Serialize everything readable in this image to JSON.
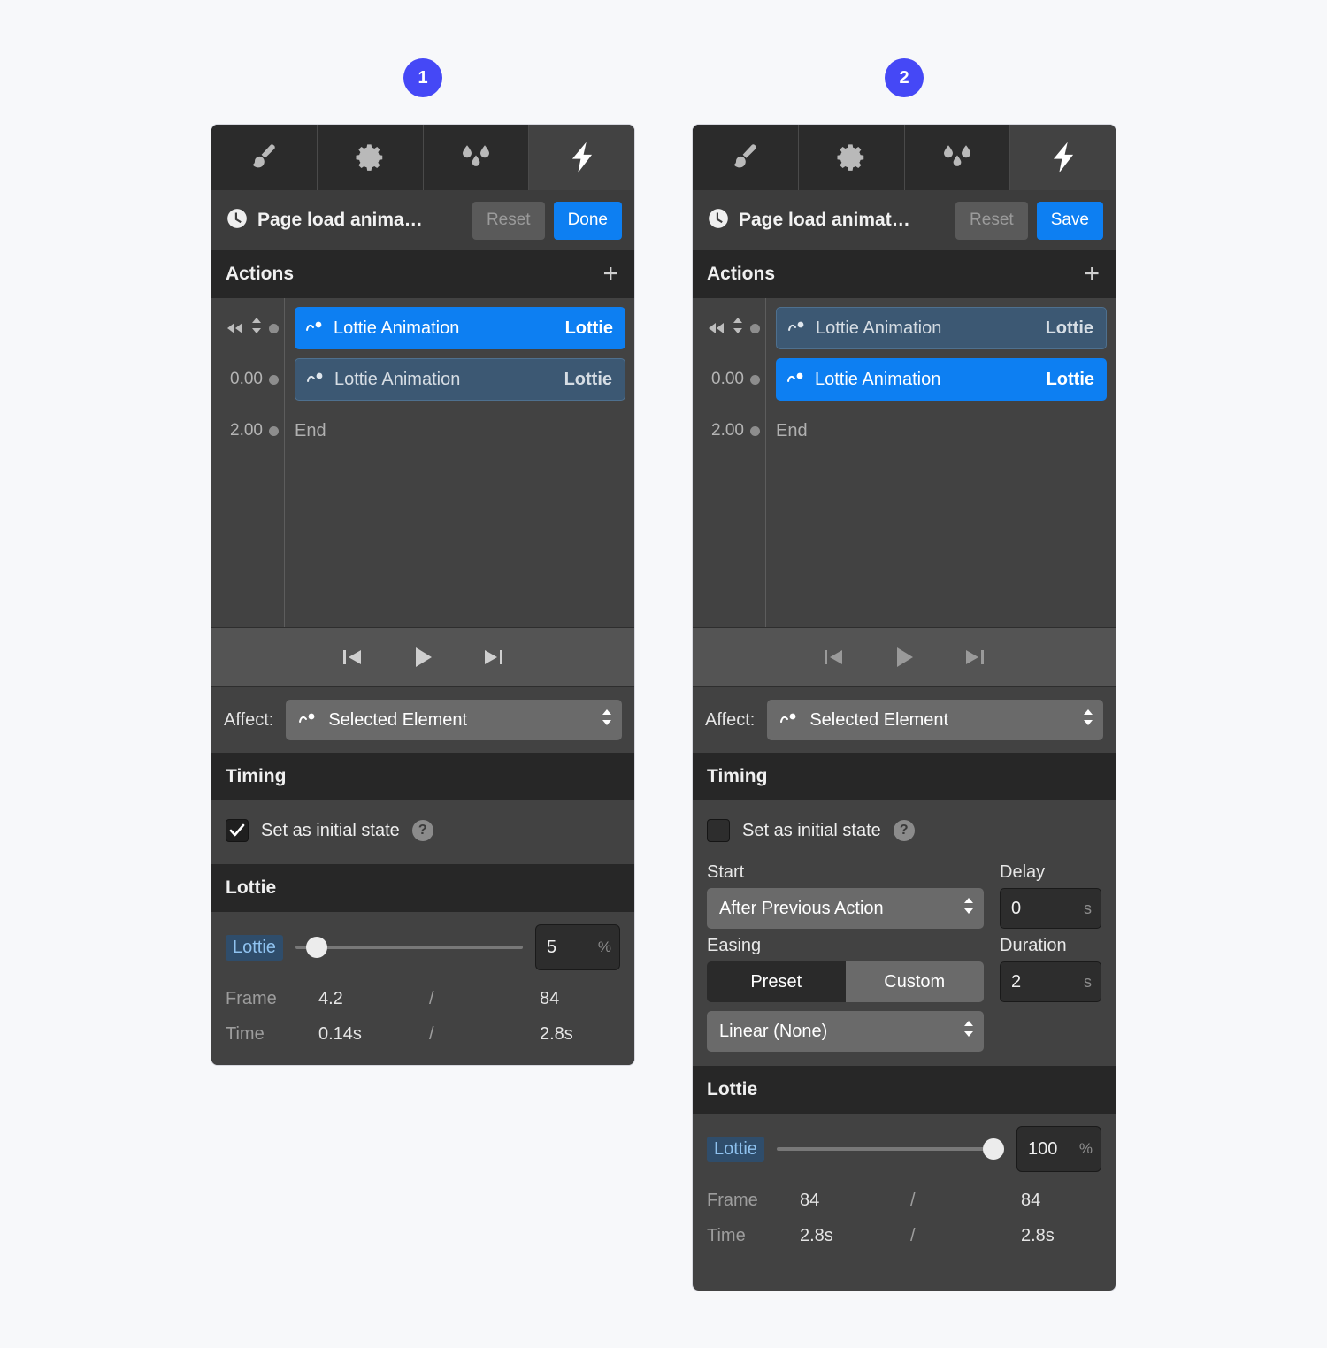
{
  "badges": [
    {
      "label": "1"
    },
    {
      "label": "2"
    }
  ],
  "accent": {
    "badge": "#4548f6",
    "primary_button": "#0d7ff2",
    "chip_selected": "#0d7ff2",
    "chip_dim": "#3c5873",
    "pill_text": "#8fc2ef"
  },
  "tabs": [
    {
      "icon": "brush-icon",
      "active": false
    },
    {
      "icon": "gear-icon",
      "active": false
    },
    {
      "icon": "droplets-icon",
      "active": false
    },
    {
      "icon": "lightning-bolt-icon",
      "active": true
    }
  ],
  "panel1": {
    "titlebar": {
      "icon": "clock-icon",
      "title": "Page load anima…",
      "reset_label": "Reset",
      "primary_label": "Done"
    },
    "actions_section": {
      "label": "Actions",
      "add_label": "+"
    },
    "timeline": {
      "rows": [
        {
          "time": "",
          "icon_rewind": "rewind-icon",
          "icon_sort": "sort-updown-icon",
          "chip_icon": "motion-path-icon",
          "name": "Lottie Animation",
          "kind": "Lottie",
          "state": "selected"
        },
        {
          "time": "0.00",
          "chip_icon": "motion-path-icon",
          "name": "Lottie Animation",
          "kind": "Lottie",
          "state": "dim"
        }
      ],
      "end_row": {
        "time": "2.00",
        "label": "End"
      }
    },
    "transport": {
      "skip_back": "skip-back-icon",
      "play": "play-icon",
      "skip_forward": "skip-forward-icon",
      "enabled": true
    },
    "affect": {
      "label": "Affect:",
      "icon": "motion-path-icon",
      "value": "Selected Element"
    },
    "timing_section": {
      "label": "Timing"
    },
    "timing": {
      "initial_state_label": "Set as initial state",
      "initial_state_checked": true,
      "help": "?"
    },
    "lottie_section": {
      "label": "Lottie"
    },
    "lottie": {
      "pill": "Lottie",
      "slider_percent": 5,
      "value": "5",
      "unit": "%",
      "rows": [
        {
          "key": "Frame",
          "current": "4.2",
          "sep": "/",
          "total": "84"
        },
        {
          "key": "Time",
          "current": "0.14s",
          "sep": "/",
          "total": "2.8s"
        }
      ]
    }
  },
  "panel2": {
    "titlebar": {
      "icon": "clock-icon",
      "title": "Page load animat…",
      "reset_label": "Reset",
      "primary_label": "Save"
    },
    "actions_section": {
      "label": "Actions",
      "add_label": "+"
    },
    "timeline": {
      "rows": [
        {
          "time": "",
          "icon_rewind": "rewind-icon",
          "icon_sort": "sort-updown-icon",
          "chip_icon": "motion-path-icon",
          "name": "Lottie Animation",
          "kind": "Lottie",
          "state": "dim"
        },
        {
          "time": "0.00",
          "chip_icon": "motion-path-icon",
          "name": "Lottie Animation",
          "kind": "Lottie",
          "state": "selected"
        }
      ],
      "end_row": {
        "time": "2.00",
        "label": "End"
      }
    },
    "transport": {
      "skip_back": "skip-back-icon",
      "play": "play-icon",
      "skip_forward": "skip-forward-icon",
      "enabled": false
    },
    "affect": {
      "label": "Affect:",
      "icon": "motion-path-icon",
      "value": "Selected Element"
    },
    "timing_section": {
      "label": "Timing"
    },
    "timing": {
      "initial_state_label": "Set as initial state",
      "initial_state_checked": false,
      "help": "?",
      "start_label": "Start",
      "start_value": "After Previous Action",
      "delay_label": "Delay",
      "delay_value": "0",
      "delay_unit": "s",
      "easing_label": "Easing",
      "easing_preset_label": "Preset",
      "easing_custom_label": "Custom",
      "easing_mode": "Custom",
      "easing_value": "Linear (None)",
      "duration_label": "Duration",
      "duration_value": "2",
      "duration_unit": "s"
    },
    "lottie_section": {
      "label": "Lottie"
    },
    "lottie": {
      "pill": "Lottie",
      "slider_percent": 100,
      "value": "100",
      "unit": "%",
      "rows": [
        {
          "key": "Frame",
          "current": "84",
          "sep": "/",
          "total": "84"
        },
        {
          "key": "Time",
          "current": "2.8s",
          "sep": "/",
          "total": "2.8s"
        }
      ]
    }
  }
}
